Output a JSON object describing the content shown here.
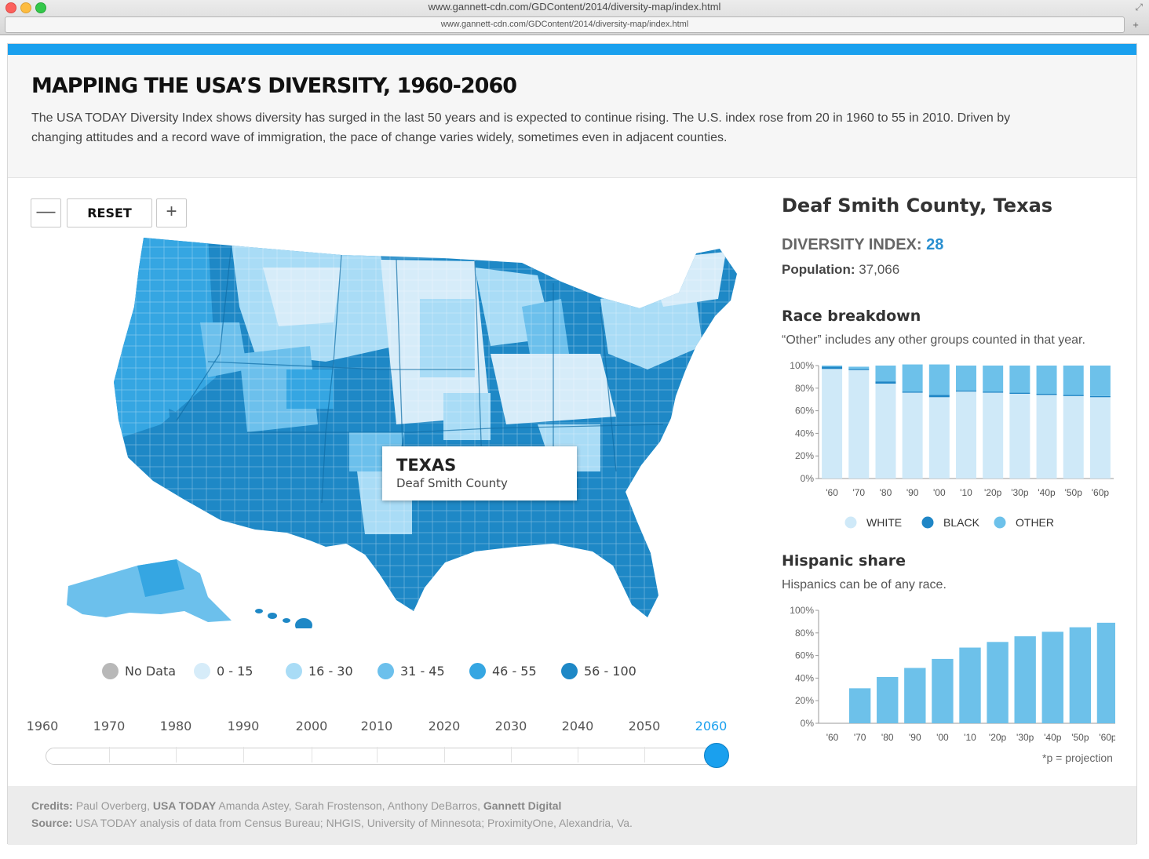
{
  "browser": {
    "window_title": "www.gannett-cdn.com/GDContent/2014/diversity-map/index.html",
    "url": "www.gannett-cdn.com/GDContent/2014/diversity-map/index.html"
  },
  "header": {
    "title": "MAPPING THE USA’S DIVERSITY, 1960-2060",
    "intro_line1": "The USA TODAY Diversity Index shows diversity has surged in the last 50 years and is expected to continue rising. The U.S. index rose from 20 in 1960 to 55 in 2010. Driven by",
    "intro_line2": "changing attitudes and a record wave of immigration, the pace of change varies widely, sometimes even in adjacent counties."
  },
  "map_controls": {
    "zoom_out": "—",
    "reset": "RESET",
    "zoom_in": "+"
  },
  "tooltip": {
    "state": "TEXAS",
    "county": "Deaf Smith County"
  },
  "legend": [
    {
      "label": "No Data",
      "color": "#b8b8b8"
    },
    {
      "label": "0 - 15",
      "color": "#d6ecf9"
    },
    {
      "label": "16 - 30",
      "color": "#a9dcf6"
    },
    {
      "label": "31 - 45",
      "color": "#6cc0ec"
    },
    {
      "label": "46 - 55",
      "color": "#35a6e2"
    },
    {
      "label": "56 - 100",
      "color": "#1e88c6"
    }
  ],
  "timeline": {
    "years": [
      "1960",
      "1970",
      "1980",
      "1990",
      "2000",
      "2010",
      "2020",
      "2030",
      "2040",
      "2050",
      "2060"
    ],
    "selected": "2060"
  },
  "side": {
    "county_title": "Deaf Smith County, Texas",
    "diversity_label": "DIVERSITY INDEX:",
    "diversity_value": "28",
    "population_label": "Population:",
    "population_value": "37,066",
    "race_title": "Race breakdown",
    "race_subtitle": "“Other” includes any other groups counted in that year.",
    "hispanic_title": "Hispanic share",
    "hispanic_subtitle": "Hispanics can be of any race.",
    "projection_note": "*p = projection"
  },
  "colors": {
    "white": "#cfe9f8",
    "black": "#1f86c6",
    "other": "#6dc1ea",
    "accent": "#1aa0ee"
  },
  "chart_data": [
    {
      "type": "bar",
      "stacked": true,
      "categories": [
        "'60",
        "'70",
        "'80",
        "'90",
        "'00",
        "'10",
        "'20p",
        "'30p",
        "'40p",
        "'50p",
        "'60p"
      ],
      "series": [
        {
          "name": "WHITE",
          "values": [
            97,
            96,
            84,
            76,
            72,
            77,
            76,
            75,
            74,
            73,
            72
          ]
        },
        {
          "name": "BLACK",
          "values": [
            2,
            1,
            2,
            1,
            2,
            1,
            1,
            1,
            1,
            1,
            1
          ]
        },
        {
          "name": "OTHER",
          "values": [
            1,
            2,
            14,
            24,
            27,
            22,
            23,
            24,
            25,
            26,
            27
          ]
        }
      ],
      "yticks": [
        "0%",
        "20%",
        "40%",
        "60%",
        "80%",
        "100%"
      ],
      "ylim": [
        0,
        100
      ]
    },
    {
      "type": "bar",
      "categories": [
        "'60",
        "'70",
        "'80",
        "'90",
        "'00",
        "'10",
        "'20p",
        "'30p",
        "'40p",
        "'50p",
        "'60p"
      ],
      "values": [
        0,
        31,
        41,
        49,
        57,
        67,
        72,
        77,
        81,
        85,
        89
      ],
      "yticks": [
        "0%",
        "20%",
        "40%",
        "60%",
        "80%",
        "100%"
      ],
      "ylim": [
        0,
        100
      ]
    }
  ],
  "footer": {
    "credits_label": "Credits:",
    "credits_person": "Paul Overberg,",
    "credits_org1": "USA TODAY",
    "credits_people2": "Amanda Astey, Sarah Frostenson, Anthony DeBarros,",
    "credits_org2": "Gannett Digital",
    "source_label": "Source:",
    "source_text": "USA TODAY analysis of data from Census Bureau; NHGIS, University of Minnesota; ProximityOne, Alexandria, Va."
  }
}
